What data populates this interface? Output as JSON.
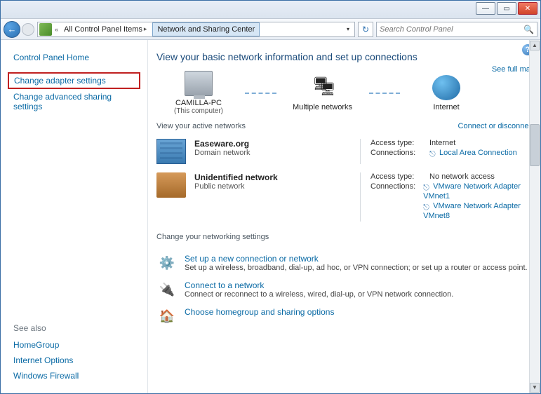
{
  "breadcrumb": {
    "parent": "All Control Panel Items",
    "current": "Network and Sharing Center"
  },
  "search": {
    "placeholder": "Search Control Panel"
  },
  "sidebar": {
    "home": "Control Panel Home",
    "adapter": "Change adapter settings",
    "advanced": "Change advanced sharing settings",
    "seealso_label": "See also",
    "seealso": [
      "HomeGroup",
      "Internet Options",
      "Windows Firewall"
    ]
  },
  "page": {
    "title": "View your basic network information and set up connections",
    "fullmap": "See full map",
    "map": {
      "computer": "CAMILLA-PC",
      "computer_sub": "(This computer)",
      "middle": "Multiple networks",
      "internet": "Internet"
    },
    "active_header": "View your active networks",
    "connect_link": "Connect or disconnect",
    "networks": [
      {
        "name": "Easeware.org",
        "type": "Domain network",
        "access_label": "Access type:",
        "access_value": "Internet",
        "conn_label": "Connections:",
        "connections": [
          "Local Area Connection"
        ]
      },
      {
        "name": "Unidentified network",
        "type": "Public network",
        "access_label": "Access type:",
        "access_value": "No network access",
        "conn_label": "Connections:",
        "connections": [
          "VMware Network Adapter VMnet1",
          "VMware Network Adapter VMnet8"
        ]
      }
    ],
    "change_header": "Change your networking settings",
    "tasks": [
      {
        "title": "Set up a new connection or network",
        "desc": "Set up a wireless, broadband, dial-up, ad hoc, or VPN connection; or set up a router or access point."
      },
      {
        "title": "Connect to a network",
        "desc": "Connect or reconnect to a wireless, wired, dial-up, or VPN network connection."
      },
      {
        "title": "Choose homegroup and sharing options",
        "desc": ""
      }
    ]
  }
}
